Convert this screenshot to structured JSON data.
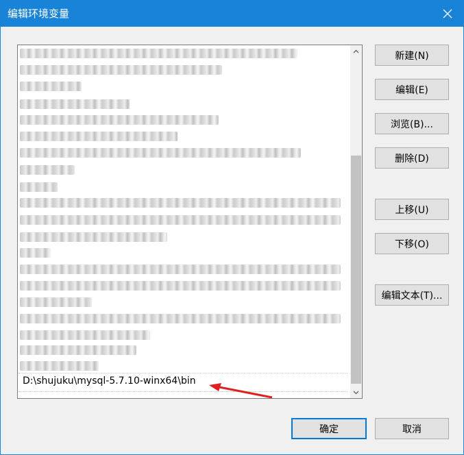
{
  "window": {
    "title": "编辑环境变量"
  },
  "list": {
    "selected_value": "D:\\shujuku\\mysql-5.7.10-winx64\\bin"
  },
  "buttons": {
    "new": "新建(N)",
    "edit": "编辑(E)",
    "browse": "浏览(B)...",
    "delete": "删除(D)",
    "move_up": "上移(U)",
    "move_down": "下移(O)",
    "edit_text": "编辑文本(T)...",
    "ok": "确定",
    "cancel": "取消"
  },
  "colors": {
    "titlebar": "#1883d7",
    "annotation_arrow": "#e02020"
  }
}
